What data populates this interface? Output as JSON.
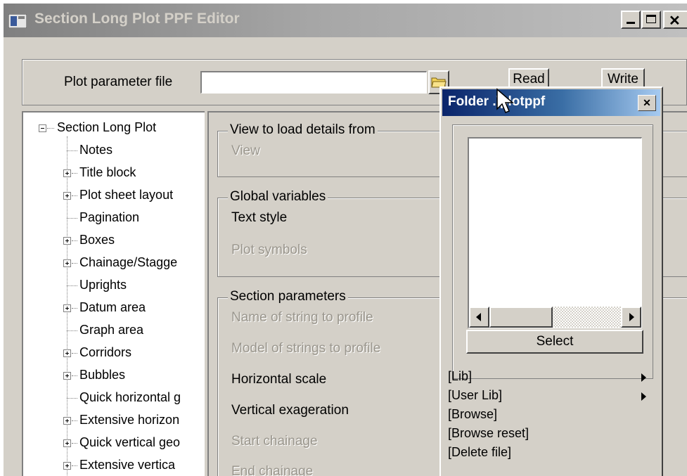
{
  "window": {
    "title": "Section Long Plot PPF Editor"
  },
  "top": {
    "file_label": "Plot parameter file",
    "file_value": "",
    "read_label": "Read",
    "write_label": "Write"
  },
  "tree": {
    "root": "Section Long Plot",
    "items": [
      {
        "label": "Notes",
        "expandable": false
      },
      {
        "label": "Title block",
        "expandable": true
      },
      {
        "label": "Plot sheet layout",
        "expandable": true
      },
      {
        "label": "Pagination",
        "expandable": false
      },
      {
        "label": "Boxes",
        "expandable": true
      },
      {
        "label": "Chainage/Stagge",
        "expandable": true
      },
      {
        "label": "Uprights",
        "expandable": false
      },
      {
        "label": "Datum area",
        "expandable": true
      },
      {
        "label": "Graph area",
        "expandable": false
      },
      {
        "label": "Corridors",
        "expandable": true
      },
      {
        "label": "Bubbles",
        "expandable": true
      },
      {
        "label": "Quick horizontal g",
        "expandable": false
      },
      {
        "label": "Extensive horizon",
        "expandable": true
      },
      {
        "label": "Quick vertical geo",
        "expandable": true
      },
      {
        "label": "Extensive vertica",
        "expandable": true
      }
    ]
  },
  "panel": {
    "view_group": "View to load details from",
    "view_label": "View",
    "global_group": "Global variables",
    "text_style": "Text style",
    "plot_symbols": "Plot symbols",
    "section_group": "Section parameters",
    "name_string": "Name of string to profile",
    "model_strings": "Model of strings to profile",
    "horizontal_scale": "Horizontal scale",
    "vertical_exaggeration": "Vertical exageration",
    "start_chainage": "Start chainage",
    "end_chainage": "End chainage"
  },
  "popup": {
    "title": "Folder .\\plotppf",
    "select_label": "Select",
    "menu": [
      {
        "label": "[Lib]",
        "submenu": true
      },
      {
        "label": "[User Lib]",
        "submenu": true
      },
      {
        "label": "[Browse]",
        "submenu": false
      },
      {
        "label": "[Browse reset]",
        "submenu": false
      },
      {
        "label": "[Delete file]",
        "submenu": false
      }
    ]
  }
}
